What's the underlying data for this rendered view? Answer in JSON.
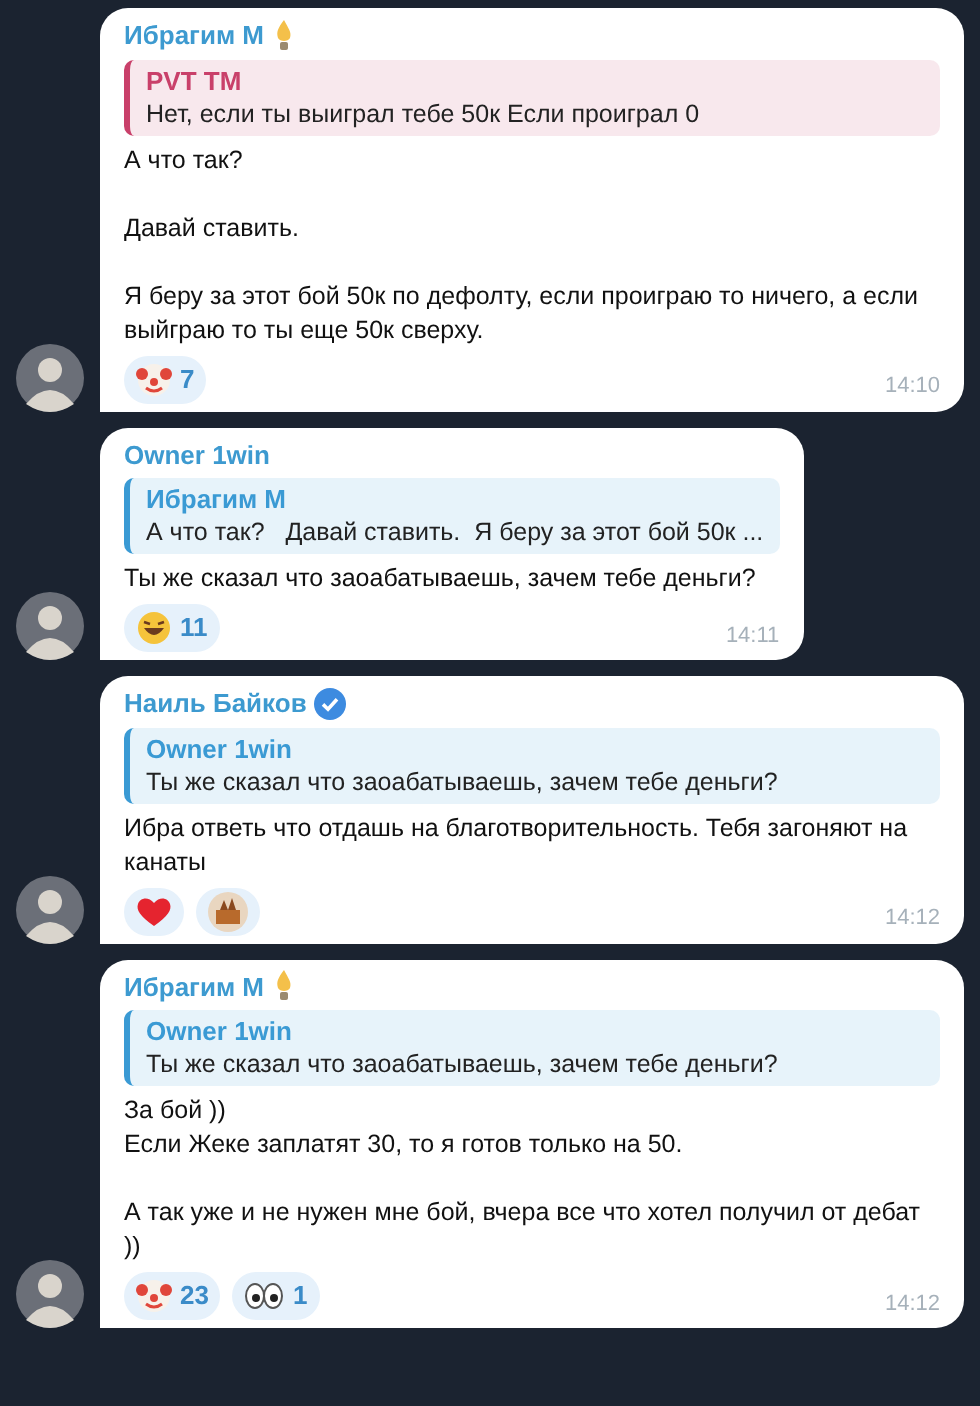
{
  "messages": [
    {
      "sender": "Ибрагим М",
      "kind": "bulb",
      "reply": {
        "author": "PVT TM",
        "text": "Нет, если ты выиграл тебе 50к Если проиграл 0",
        "color": "#c9406a"
      },
      "text": "А что так?\n\nДавай ставить.\n\nЯ беру за этот бой 50к по дефолту, если проиграю то ничего, а если выйграю то ты еще 50к сверху.",
      "reactions": [
        {
          "kind": "clown",
          "count": "7"
        }
      ],
      "time": "14:10"
    },
    {
      "sender": "Owner 1win",
      "kind": "plain",
      "reply": {
        "author": "Ибрагим М",
        "text": "А что так?   Давай ставить.  Я беру за этот бой 50к ...",
        "color": "#3a9ad4"
      },
      "text": "Ты же сказал что заоабатываешь, зачем тебе деньги?",
      "reactions": [
        {
          "kind": "laugh",
          "count": "11"
        }
      ],
      "time": "14:11"
    },
    {
      "sender": "Наиль Байков",
      "kind": "verified",
      "reply": {
        "author": "Owner 1win",
        "text": "Ты же сказал что заоабатываешь, зачем тебе деньги?",
        "color": "#3a9ad4"
      },
      "text": "Ибра ответь что отдашь на благотворительность. Тебя загоняют на канаты",
      "reactions": [
        {
          "kind": "heart"
        },
        {
          "kind": "castle"
        }
      ],
      "time": "14:12"
    },
    {
      "sender": "Ибрагим М",
      "kind": "bulb",
      "reply": {
        "author": "Owner 1win",
        "text": "Ты же сказал что заоабатываешь, зачем тебе деньги?",
        "color": "#3a9ad4"
      },
      "text": "За бой ))\nЕсли Жеке заплатят 30, то я готов только на 50.\n\nА так уже и не нужен мне бой, вчера все что хотел получил от дебат ))",
      "reactions": [
        {
          "kind": "clown",
          "count": "23"
        },
        {
          "kind": "eyes",
          "count": "1"
        }
      ],
      "time": "14:12"
    }
  ]
}
